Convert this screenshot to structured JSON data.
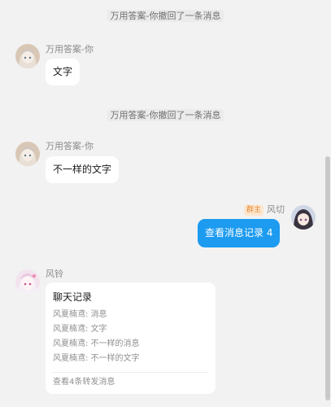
{
  "messages": {
    "recall_1": "万用答案-你撤回了一条消息",
    "recall_2": "万用答案-你撤回了一条消息",
    "msg1": {
      "sender": "万用答案-你",
      "text": "文字"
    },
    "msg2": {
      "sender": "万用答案-你",
      "text": "不一样的文字"
    },
    "msg3": {
      "sender": "风切",
      "role": "群主",
      "text": "查看消息记录 4"
    },
    "msg4": {
      "sender": "风铃",
      "forward": {
        "title": "聊天记录",
        "lines": [
          "风夏楠鸢: 消息",
          "风夏楠鸢: 文字",
          "风夏楠鸢: 不一样的消息",
          "风夏楠鸢: 不一样的文字"
        ],
        "footer": "查看4条转发消息"
      }
    }
  },
  "colors": {
    "background": "#f2f2f2",
    "bubble": "#ffffff",
    "self_bubble": "#1d9bf0",
    "owner_badge_bg": "#fde6cf",
    "owner_badge_text": "#e78a2d"
  },
  "icons": {
    "avatar_1": "anime-girl-avatar",
    "avatar_2": "anime-girl-avatar",
    "avatar_3": "anime-girl-avatar",
    "avatar_4": "anime-girl-avatar"
  }
}
